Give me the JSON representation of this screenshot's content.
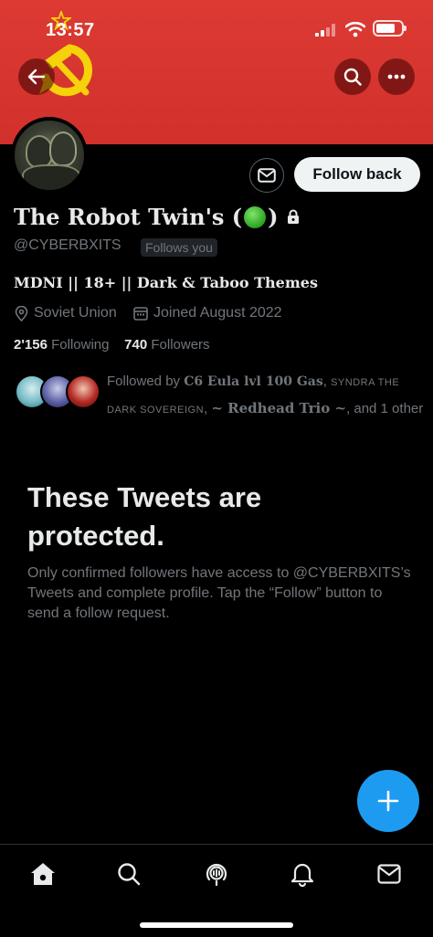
{
  "status_bar": {
    "time": "13:57"
  },
  "profile": {
    "display_name_pre": "The Robot Twin's (",
    "display_name_post": ")",
    "handle": "@CYBERBXITS",
    "follows_you_label": "Follows you",
    "bio": "MDNI || 18+ || Dark & Taboo Themes",
    "location": "Soviet Union",
    "joined": "Joined August 2022",
    "following_count": "2'156",
    "following_label": "Following",
    "followers_count": "740",
    "followers_label": "Followers",
    "followed_by": {
      "prefix": "Followed by ",
      "name1": "C6 Eula lvl 100 Gas",
      "sep1": ", ",
      "name2": "SYNDRA THE DARK SOVEREIGN",
      "sep2": ", ",
      "name3": "~ Redhead Trio ~",
      "suffix": ", and 1 other"
    }
  },
  "actions": {
    "follow_back_label": "Follow back"
  },
  "protected": {
    "title": "These Tweets are protected.",
    "body": "Only confirmed followers have access to @CYBERBXITS’s Tweets and complete profile. Tap the “Follow” button to send a follow request."
  },
  "icons": {
    "back": "arrow-left-icon",
    "search": "search-icon",
    "more": "more-icon",
    "message": "envelope-icon",
    "compose": "plus-icon",
    "tabs": [
      "home-icon",
      "search-icon",
      "spaces-icon",
      "bell-icon",
      "envelope-icon"
    ]
  },
  "colors": {
    "banner": "#d2302b",
    "accent": "#1d9bf0",
    "muted": "#71767b",
    "text": "#e7e9ea",
    "hammer_sickle": "#f5d20a"
  }
}
